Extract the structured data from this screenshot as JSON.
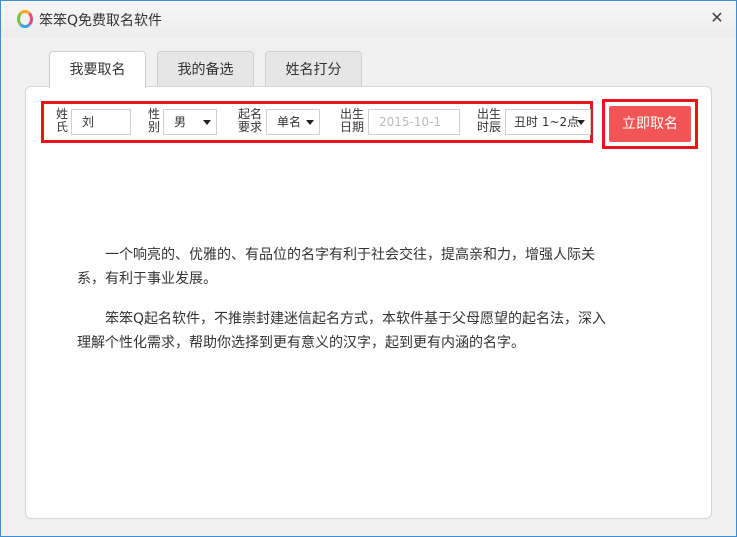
{
  "window": {
    "title": "笨笨Q免费取名软件",
    "close_glyph": "✕"
  },
  "tabs": [
    {
      "label": "我要取名",
      "active": true
    },
    {
      "label": "我的备选",
      "active": false
    },
    {
      "label": "姓名打分",
      "active": false
    }
  ],
  "form": {
    "surname_label_1": "姓",
    "surname_label_2": "氏",
    "surname_value": "刘",
    "gender_label_1": "性",
    "gender_label_2": "别",
    "gender_value": "男",
    "naming_label_1": "起名",
    "naming_label_2": "要求",
    "naming_value": "单名",
    "birthdate_label_1": "出生",
    "birthdate_label_2": "日期",
    "birthdate_placeholder": "2015-10-1",
    "birthtime_label_1": "出生",
    "birthtime_label_2": "时辰",
    "birthtime_value": "丑时 1~2点"
  },
  "submit_label": "立即取名",
  "paragraphs": [
    "一个响亮的、优雅的、有品位的名字有利于社会交往，提高亲和力，增强人际关系，有利于事业发展。",
    "笨笨Q起名软件，不推崇封建迷信起名方式，本软件基于父母愿望的起名法，深入理解个性化需求，帮助你选择到更有意义的汉字，起到更有内涵的名字。"
  ],
  "colors": {
    "accent": "#f25555",
    "highlight_border": "#e8141a",
    "window_border": "#3a8ed6"
  }
}
